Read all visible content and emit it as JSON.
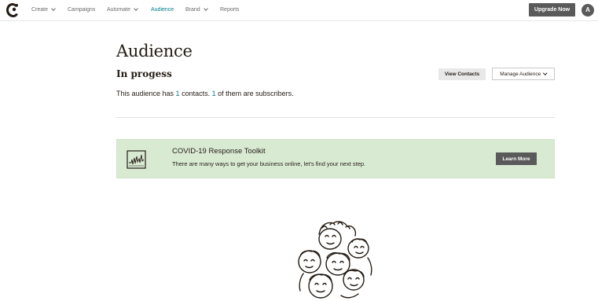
{
  "nav": {
    "items": [
      {
        "label": "Create",
        "dropdown": true,
        "active": false
      },
      {
        "label": "Campaigns",
        "dropdown": false,
        "active": false
      },
      {
        "label": "Automate",
        "dropdown": true,
        "active": false
      },
      {
        "label": "Audience",
        "dropdown": false,
        "active": true
      },
      {
        "label": "Brand",
        "dropdown": true,
        "active": false
      },
      {
        "label": "Reports",
        "dropdown": false,
        "active": false
      }
    ],
    "upgrade_label": "Upgrade Now",
    "avatar_initial": "A",
    "logo_icon": "mailchimp-logo-icon"
  },
  "page": {
    "title": "Audience",
    "audience_name": "In progess",
    "view_contacts_label": "View Contacts",
    "manage_audience_label": "Manage Audience",
    "summary": {
      "prefix": "This audience has ",
      "contacts": "1",
      "middle": " contacts. ",
      "subscribers": "1",
      "suffix": " of them are subscribers."
    }
  },
  "banner": {
    "icon": "chart-line-icon",
    "title": "COVID-19 Response Toolkit",
    "text": "There are many ways to get your business online, let's find your next step.",
    "button_label": "Learn More"
  },
  "illustration": {
    "icon": "group-of-faces-illustration"
  },
  "colors": {
    "accent": "#007c89",
    "dark_button": "#5a5a5a",
    "banner_bg": "#d9ead3",
    "text": "#241c15"
  }
}
